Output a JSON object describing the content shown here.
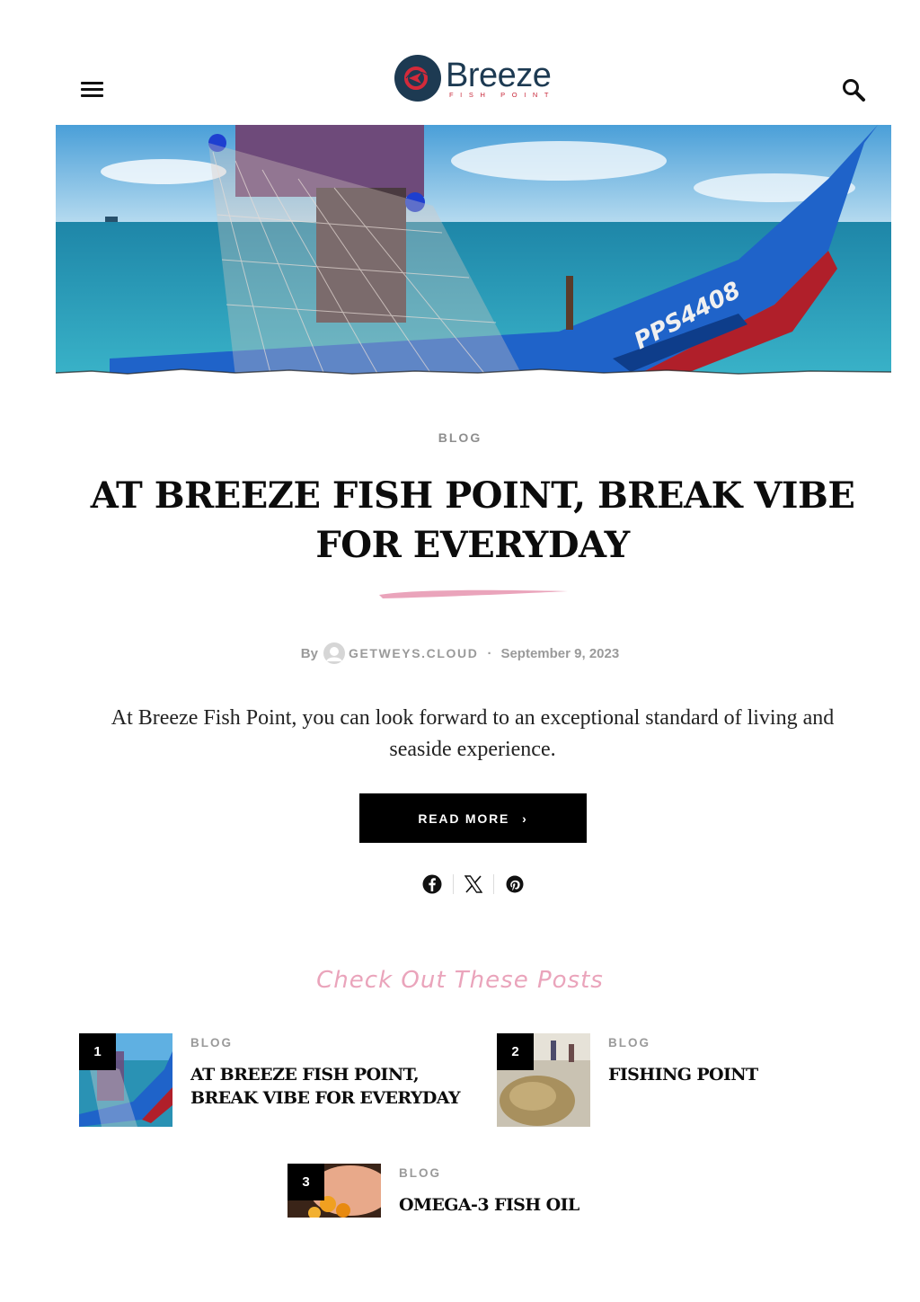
{
  "header": {
    "logo_name": "Breeze",
    "logo_tagline": "FISH POINT",
    "menu_icon": "hamburger-menu-icon",
    "search_icon": "search-icon"
  },
  "hero": {
    "image_description_icon": "fisherman-boat-image",
    "boat_registration": "PPS4408"
  },
  "article": {
    "category": "BLOG",
    "title": "AT BREEZE FISH POINT, BREAK VIBE FOR EVERYDAY",
    "by_label": "By",
    "author": "GETWEYS.CLOUD",
    "separator": "·",
    "date": "September 9, 2023",
    "excerpt": "At Breeze Fish Point, you can look forward to an exceptional standard of living and seaside experience.",
    "read_more_label": "READ MORE",
    "read_more_chevron": "›",
    "share_icons": [
      "facebook-icon",
      "x-twitter-icon",
      "pinterest-icon"
    ]
  },
  "related": {
    "heading": "Check Out These Posts",
    "posts": [
      {
        "number": "1",
        "category": "BLOG",
        "title": "AT BREEZE FISH POINT, BREAK VIBE FOR EVERYDAY"
      },
      {
        "number": "2",
        "category": "BLOG",
        "title": "FISHING POINT"
      },
      {
        "number": "3",
        "category": "BLOG",
        "title": "OMEGA-3 FISH OIL"
      }
    ]
  },
  "colors": {
    "accent_pink": "#eaa4bb",
    "logo_navy": "#1d3a52",
    "logo_red": "#c8283a",
    "button_black": "#000000"
  }
}
